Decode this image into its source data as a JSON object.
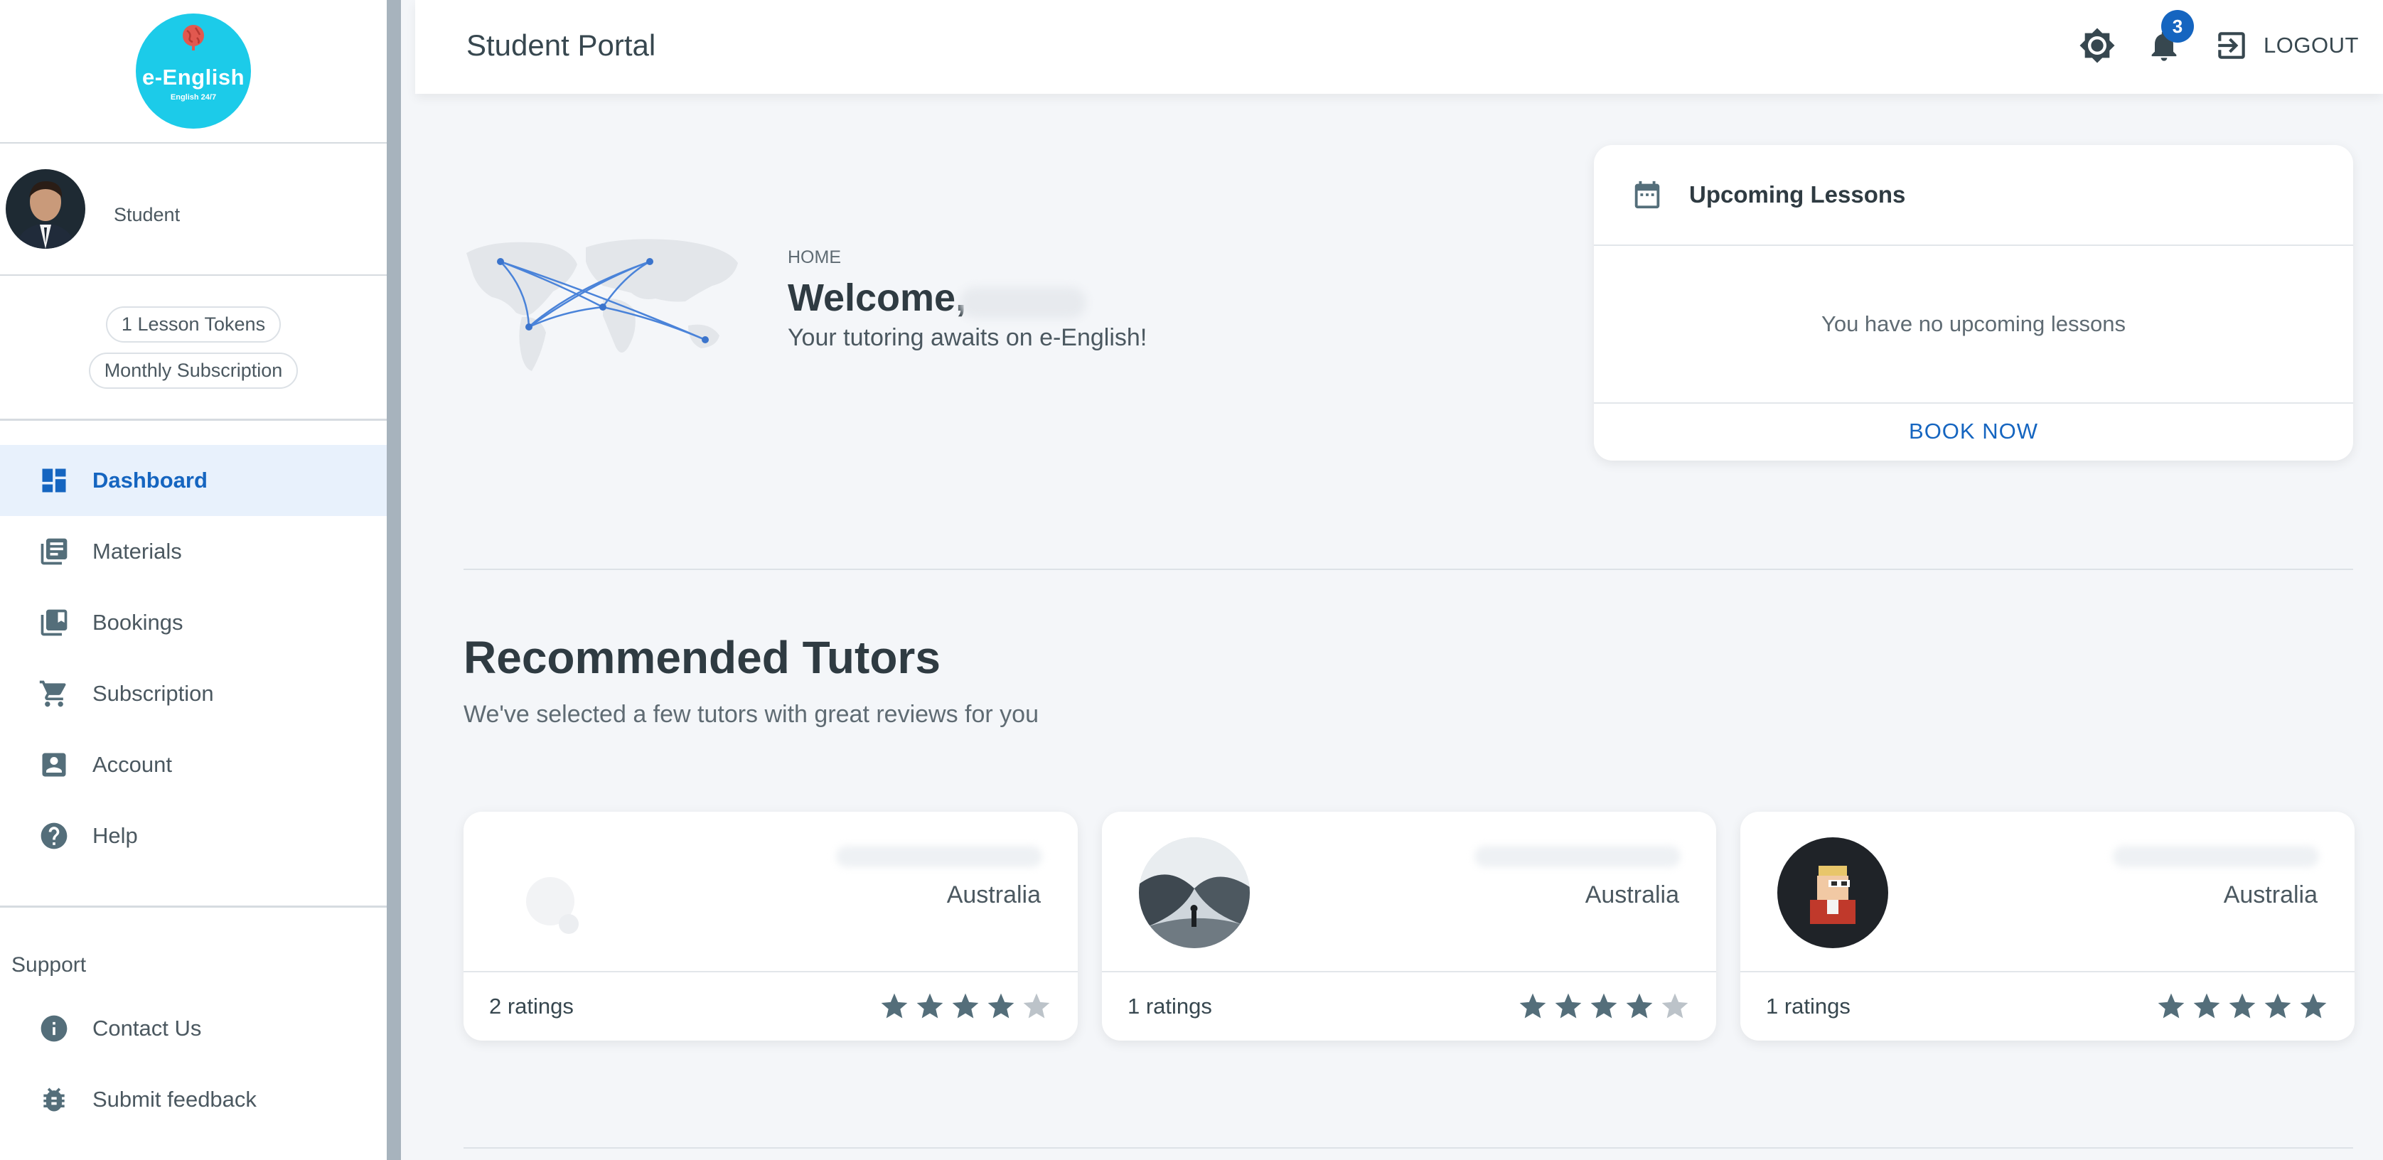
{
  "brand": {
    "name": "e-English",
    "tagline": "English 24/7",
    "color": "#1ccbe9"
  },
  "profile": {
    "role": "Student"
  },
  "tokens": {
    "lesson_tokens": "1 Lesson Tokens",
    "subscription": "Monthly Subscription"
  },
  "nav": {
    "items": [
      {
        "label": "Dashboard",
        "icon": "dashboard-icon",
        "active": true
      },
      {
        "label": "Materials",
        "icon": "library-books-icon"
      },
      {
        "label": "Bookings",
        "icon": "bookmarks-icon"
      },
      {
        "label": "Subscription",
        "icon": "shopping-cart-icon"
      },
      {
        "label": "Account",
        "icon": "account-box-icon"
      },
      {
        "label": "Help",
        "icon": "help-circle-icon"
      }
    ],
    "support_heading": "Support",
    "support_items": [
      {
        "label": "Contact Us",
        "icon": "info-icon"
      },
      {
        "label": "Submit feedback",
        "icon": "bug-icon"
      }
    ]
  },
  "header": {
    "title": "Student Portal",
    "notification_count": "3",
    "logout_label": "LOGOUT",
    "accent": "#1565c0"
  },
  "hero": {
    "breadcrumb": "HOME",
    "welcome": "Welcome,",
    "tagline": "Your tutoring awaits on e-English!"
  },
  "lessons": {
    "title": "Upcoming Lessons",
    "empty_text": "You have no upcoming lessons",
    "book_label": "BOOK NOW"
  },
  "recommended": {
    "title": "Recommended Tutors",
    "subtitle": "We've selected a few tutors with great reviews for you",
    "tutors": [
      {
        "country": "Australia",
        "ratings": "2 ratings",
        "stars": 4
      },
      {
        "country": "Australia",
        "ratings": "1 ratings",
        "stars": 4
      },
      {
        "country": "Australia",
        "ratings": "1 ratings",
        "stars": 5
      }
    ]
  }
}
